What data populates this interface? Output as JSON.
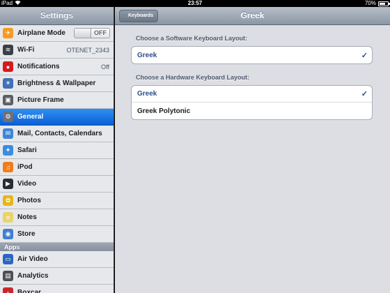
{
  "statusbar": {
    "device": "iPad",
    "time": "23:57",
    "battery": "70%",
    "battery_level": 0.7
  },
  "sidebar": {
    "title": "Settings",
    "items": [
      {
        "label": "Airplane Mode",
        "icon": "airplane-icon",
        "color": "#f79a1e",
        "toggle": "OFF"
      },
      {
        "label": "Wi-Fi",
        "icon": "wifi-icon",
        "color": "#3a3f47",
        "value": "OTENET_2343"
      },
      {
        "label": "Notifications",
        "icon": "notifications-icon",
        "color": "#d7191b",
        "value": "Off"
      },
      {
        "label": "Brightness & Wallpaper",
        "icon": "brightness-icon",
        "color": "#3f6fb7"
      },
      {
        "label": "Picture Frame",
        "icon": "picture-frame-icon",
        "color": "#5a5f66"
      },
      {
        "label": "General",
        "icon": "gear-icon",
        "color": "#6d7177",
        "selected": true
      },
      {
        "label": "Mail, Contacts, Calendars",
        "icon": "mail-icon",
        "color": "#3d86d6"
      },
      {
        "label": "Safari",
        "icon": "safari-icon",
        "color": "#3b8de0"
      },
      {
        "label": "iPod",
        "icon": "ipod-icon",
        "color": "#f07d18"
      },
      {
        "label": "Video",
        "icon": "video-icon",
        "color": "#2a2d33"
      },
      {
        "label": "Photos",
        "icon": "photos-icon",
        "color": "#e6b619"
      },
      {
        "label": "Notes",
        "icon": "notes-icon",
        "color": "#e9d46a"
      },
      {
        "label": "Store",
        "icon": "store-icon",
        "color": "#3d7fd2"
      }
    ],
    "apps_header": "Apps",
    "apps": [
      {
        "label": "Air Video",
        "icon": "air-video-icon",
        "color": "#2a66c2"
      },
      {
        "label": "Analytics",
        "icon": "analytics-icon",
        "color": "#4d4f52"
      },
      {
        "label": "Boxcar",
        "icon": "boxcar-icon",
        "color": "#c9262b"
      }
    ]
  },
  "detail": {
    "back_label": "Keyboards",
    "title": "Greek",
    "software_header": "Choose a Software Keyboard Layout:",
    "software_options": [
      {
        "label": "Greek",
        "checked": true
      }
    ],
    "hardware_header": "Choose a Hardware Keyboard Layout:",
    "hardware_options": [
      {
        "label": "Greek",
        "checked": true
      },
      {
        "label": "Greek Polytonic",
        "checked": false
      }
    ],
    "check_glyph": "✓"
  }
}
